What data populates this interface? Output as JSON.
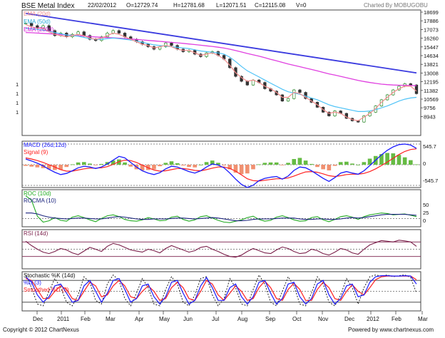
{
  "colors": {
    "ema20": "#f28c8c",
    "ema50": "#4fc3f7",
    "ema200": "#e040e0",
    "trendline": "#3a3adf",
    "candle_up": "#2e8b2e",
    "candle_down": "#333333",
    "macd": "#1a1aff",
    "signal": "#ff2020",
    "hist_pos": "#66bb44",
    "hist_neg": "#f09070",
    "roc": "#22aa22",
    "rocma": "#1a237e",
    "rsi": "#7a1f4a",
    "stoch_k": "#2222cc",
    "stoch_d": "#1a1aff",
    "stoch_sd": "#ff2020",
    "panel_border": "#444444",
    "dotted": "#666666"
  },
  "header": {
    "title": "BSE Metal Index",
    "date": "22/02/2012",
    "open": "O=12729.74",
    "high": "H=12781.68",
    "low": "L=12071.51",
    "close": "C=12115.08",
    "volume": "V=0",
    "charted_by": "Charted By MOBUGOBU"
  },
  "legends": {
    "main": [
      "EMA (20d)",
      "EMA (50d)",
      "EMA (200d)"
    ],
    "macd": [
      "MACD (26d,12d)",
      "Signal (9)"
    ],
    "roc": [
      "ROC (10d)",
      "ROCMA (10)"
    ],
    "rsi": [
      "RSI (14d)"
    ],
    "stoch": [
      "Stochastic %K (14d)",
      "%D (3)",
      "Smoothed %D (3)"
    ]
  },
  "axes": {
    "price_ticks": [
      "18699",
      "17886",
      "17073",
      "16260",
      "15447",
      "14634",
      "13821",
      "13008",
      "12195",
      "11382",
      "10569",
      "9756",
      "8943"
    ],
    "left_ticks": [
      "1",
      "1",
      "1",
      "1"
    ],
    "macd_ticks": [
      "545.7",
      "0",
      "-545.7"
    ],
    "roc_ticks": [
      "50",
      "25",
      "0"
    ],
    "months": [
      "Dec",
      "2011",
      "Feb",
      "Mar",
      "Apr",
      "May",
      "Jun",
      "Jul",
      "Aug",
      "Sep",
      "Oct",
      "Nov",
      "Dec",
      "2012",
      "Feb",
      "Mar"
    ]
  },
  "footer": {
    "copyright": "Copyright © 2012 ChartNexus",
    "powered": "Powered by www.chartnexus.com"
  },
  "chart_data": {
    "type": "line",
    "panels": [
      "price-candlestick",
      "macd",
      "roc",
      "rsi",
      "stochastic"
    ],
    "x_range": [
      "2010-12",
      "2012-02-22"
    ],
    "price": {
      "ylim": [
        8943,
        18699
      ],
      "close": [
        17800,
        17600,
        17400,
        17600,
        17200,
        16800,
        17000,
        16700,
        16900,
        17100,
        16800,
        16500,
        16400,
        16700,
        17000,
        17200,
        17000,
        16700,
        16500,
        16300,
        16100,
        15900,
        15700,
        15900,
        16200,
        16000,
        15700,
        15500,
        15600,
        15300,
        15100,
        15400,
        15500,
        15200,
        14900,
        14200,
        13500,
        13100,
        12800,
        13200,
        13000,
        12500,
        12300,
        12000,
        11500,
        11700,
        12400,
        12200,
        11700,
        11400,
        11000,
        10600,
        10300,
        10700,
        10500,
        10100,
        9900,
        9800,
        10300,
        10600,
        11100,
        11600,
        12000,
        12400,
        12700,
        12900,
        12800,
        12100
      ],
      "ema20": [
        17700,
        17500,
        17400,
        17400,
        17100,
        16900,
        16800,
        16700,
        16800,
        16900,
        16800,
        16600,
        16500,
        16600,
        16800,
        17000,
        16900,
        16700,
        16500,
        16300,
        16100,
        16000,
        15800,
        15900,
        16000,
        15900,
        15700,
        15600,
        15600,
        15400,
        15200,
        15300,
        15400,
        15200,
        14900,
        14400,
        13800,
        13400,
        13100,
        13200,
        13000,
        12700,
        12500,
        12200,
        11800,
        11800,
        12200,
        12100,
        11800,
        11500,
        11200,
        10800,
        10500,
        10600,
        10500,
        10200,
        10000,
        9900,
        10200,
        10500,
        10900,
        11400,
        11800,
        12200,
        12500,
        12700,
        12700,
        12300
      ],
      "ema50": [
        17400,
        17350,
        17300,
        17250,
        17150,
        17050,
        16950,
        16850,
        16800,
        16750,
        16650,
        16550,
        16500,
        16500,
        16550,
        16600,
        16550,
        16500,
        16450,
        16350,
        16250,
        16150,
        16050,
        16000,
        15950,
        15900,
        15850,
        15800,
        15750,
        15650,
        15550,
        15500,
        15450,
        15400,
        15300,
        15050,
        14700,
        14300,
        13950,
        13700,
        13450,
        13200,
        12950,
        12700,
        12450,
        12250,
        12150,
        12050,
        11900,
        11750,
        11600,
        11400,
        11200,
        11050,
        10950,
        10850,
        10750,
        10650,
        10650,
        10700,
        10800,
        10950,
        11100,
        11300,
        11500,
        11650,
        11750,
        11800
      ],
      "ema200": [
        17050,
        17030,
        17000,
        16980,
        16950,
        16920,
        16880,
        16850,
        16820,
        16790,
        16760,
        16720,
        16690,
        16660,
        16640,
        16620,
        16590,
        16560,
        16520,
        16490,
        16450,
        16410,
        16370,
        16330,
        16290,
        16250,
        16210,
        16170,
        16120,
        16070,
        16020,
        15970,
        15920,
        15860,
        15790,
        15700,
        15590,
        15470,
        15350,
        15240,
        15130,
        15010,
        14880,
        14760,
        14630,
        14500,
        14390,
        14280,
        14170,
        14060,
        13940,
        13820,
        13700,
        13600,
        13500,
        13390,
        13280,
        13170,
        13080,
        13000,
        12930,
        12870,
        12830,
        12800,
        12780,
        12770,
        12760,
        12740
      ],
      "trendline": [
        [
          0,
          18600
        ],
        [
          1,
          13780
        ]
      ]
    },
    "macd": {
      "ylim": [
        -545.7,
        545.7
      ],
      "macd": [
        150,
        100,
        40,
        -30,
        -120,
        -200,
        -260,
        -230,
        -160,
        -80,
        -40,
        -60,
        -100,
        -60,
        20,
        120,
        220,
        180,
        60,
        -60,
        -160,
        -220,
        -260,
        -210,
        -110,
        -40,
        -60,
        -120,
        -180,
        -220,
        -160,
        -60,
        20,
        -10,
        -80,
        -220,
        -380,
        -520,
        -600,
        -540,
        -420,
        -360,
        -330,
        -310,
        -380,
        -300,
        -150,
        -60,
        -80,
        -160,
        -260,
        -360,
        -440,
        -340,
        -220,
        -180,
        -220,
        -250,
        -160,
        -20,
        120,
        260,
        380,
        470,
        530,
        545,
        520,
        430
      ],
      "signal": [
        180,
        150,
        110,
        60,
        0,
        -60,
        -130,
        -170,
        -170,
        -140,
        -110,
        -90,
        -90,
        -80,
        -50,
        10,
        80,
        120,
        110,
        60,
        -10,
        -80,
        -140,
        -170,
        -160,
        -130,
        -100,
        -100,
        -120,
        -150,
        -160,
        -130,
        -90,
        -60,
        -60,
        -100,
        -170,
        -270,
        -370,
        -420,
        -430,
        -410,
        -390,
        -370,
        -370,
        -350,
        -300,
        -240,
        -190,
        -180,
        -200,
        -240,
        -290,
        -310,
        -290,
        -260,
        -250,
        -250,
        -230,
        -180,
        -110,
        -20,
        70,
        170,
        270,
        350,
        400,
        420
      ],
      "histogram": [
        -30,
        -50,
        -70,
        -90,
        -120,
        -140,
        -130,
        -60,
        10,
        60,
        70,
        30,
        -10,
        20,
        70,
        110,
        140,
        60,
        -50,
        -120,
        -150,
        -140,
        -120,
        -40,
        50,
        90,
        40,
        -20,
        -60,
        -70,
        0,
        70,
        110,
        50,
        -20,
        -120,
        -210,
        -250,
        -230,
        -120,
        10,
        50,
        60,
        60,
        -10,
        50,
        150,
        180,
        110,
        20,
        -60,
        -120,
        -150,
        -30,
        70,
        80,
        30,
        0,
        70,
        160,
        230,
        280,
        310,
        300,
        260,
        195,
        120,
        10
      ]
    },
    "roc": {
      "ylim": [
        -15,
        60
      ],
      "roc": [
        50,
        40,
        5,
        -8,
        -5,
        2,
        -4,
        -6,
        3,
        6,
        2,
        -3,
        -7,
        0,
        6,
        8,
        4,
        -2,
        -5,
        -6,
        -3,
        2,
        -1,
        -5,
        -4,
        3,
        5,
        -2,
        -6,
        -3,
        4,
        6,
        1,
        -4,
        -8,
        -9,
        -6,
        -3,
        2,
        5,
        -2,
        -6,
        -4,
        3,
        6,
        2,
        -3,
        -6,
        -5,
        2,
        4,
        -3,
        -7,
        -2,
        4,
        6,
        3,
        -2,
        4,
        8,
        10,
        12,
        11,
        8,
        9,
        10,
        7,
        4
      ],
      "rocma": [
        12,
        12,
        10,
        6,
        3,
        1,
        0,
        -1,
        0,
        1,
        1,
        0,
        -1,
        -1,
        1,
        3,
        4,
        3,
        1,
        -1,
        -2,
        -2,
        -1,
        -1,
        -1,
        0,
        1,
        1,
        0,
        -1,
        0,
        1,
        2,
        1,
        -1,
        -3,
        -5,
        -5,
        -4,
        -2,
        -1,
        -1,
        -1,
        0,
        1,
        1,
        1,
        -1,
        -2,
        -2,
        -1,
        -1,
        -2,
        -2,
        -1,
        1,
        2,
        1,
        2,
        4,
        6,
        8,
        9,
        9,
        9,
        9,
        8,
        7
      ]
    },
    "rsi": {
      "ylim": [
        0,
        100
      ],
      "levels": [
        30,
        50,
        70
      ],
      "rsi": [
        72,
        60,
        50,
        42,
        38,
        44,
        52,
        48,
        40,
        35,
        45,
        55,
        50,
        44,
        58,
        66,
        62,
        55,
        48,
        45,
        42,
        50,
        46,
        40,
        52,
        60,
        54,
        48,
        42,
        46,
        55,
        58,
        50,
        44,
        36,
        30,
        28,
        34,
        44,
        52,
        46,
        40,
        38,
        48,
        56,
        52,
        44,
        38,
        40,
        50,
        46,
        38,
        34,
        42,
        52,
        48,
        40,
        36,
        50,
        62,
        68,
        74,
        72,
        70,
        75,
        73,
        70,
        58
      ]
    },
    "stochastic": {
      "ylim": [
        0,
        100
      ],
      "levels": [
        20,
        50,
        80
      ],
      "k": [
        95,
        60,
        15,
        10,
        50,
        85,
        60,
        20,
        10,
        40,
        90,
        75,
        25,
        15,
        70,
        95,
        80,
        30,
        10,
        45,
        85,
        60,
        15,
        10,
        55,
        90,
        70,
        20,
        10,
        40,
        85,
        90,
        40,
        10,
        30,
        85,
        60,
        15,
        10,
        55,
        95,
        70,
        20,
        10,
        50,
        90,
        65,
        15,
        10,
        45,
        90,
        70,
        20,
        10,
        40,
        85,
        60,
        15,
        60,
        90,
        95,
        92,
        95,
        90,
        93,
        95,
        88,
        45
      ],
      "d": [
        90,
        75,
        40,
        20,
        35,
        65,
        70,
        45,
        20,
        25,
        65,
        80,
        50,
        20,
        45,
        80,
        85,
        55,
        20,
        30,
        65,
        70,
        35,
        15,
        35,
        75,
        80,
        45,
        15,
        25,
        65,
        88,
        60,
        25,
        25,
        60,
        70,
        35,
        15,
        35,
        75,
        80,
        45,
        15,
        30,
        70,
        75,
        35,
        15,
        30,
        70,
        80,
        40,
        15,
        30,
        65,
        70,
        35,
        40,
        75,
        90,
        93,
        93,
        92,
        92,
        93,
        92,
        70
      ],
      "smoothed_d": [
        85,
        80,
        55,
        30,
        30,
        50,
        65,
        55,
        30,
        25,
        50,
        75,
        65,
        35,
        40,
        65,
        80,
        65,
        35,
        30,
        50,
        65,
        50,
        25,
        30,
        60,
        75,
        60,
        30,
        25,
        50,
        80,
        70,
        40,
        25,
        45,
        65,
        50,
        25,
        30,
        60,
        78,
        60,
        30,
        25,
        55,
        72,
        55,
        25,
        25,
        55,
        75,
        60,
        30,
        25,
        50,
        68,
        50,
        40,
        60,
        82,
        90,
        92,
        92,
        92,
        92,
        92,
        82
      ]
    }
  }
}
